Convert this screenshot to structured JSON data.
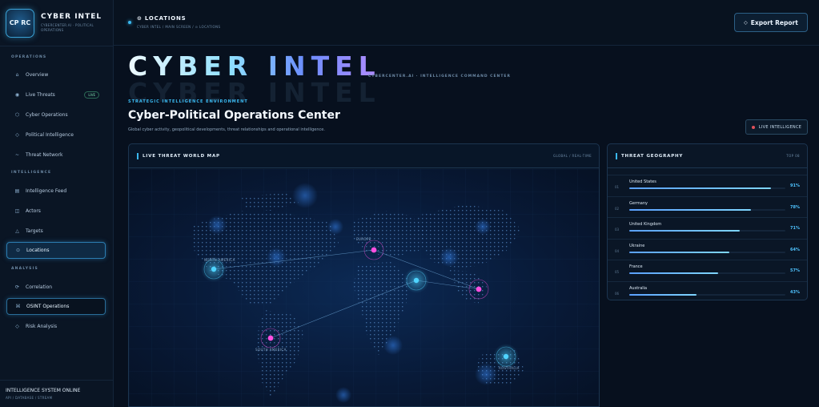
{
  "brand": {
    "logo_text": "CP RC",
    "title": "CYBER INTEL",
    "subtitle": "CYBERCENTER.AI · POLITICAL OPERATIONS"
  },
  "sidebar": {
    "sections": [
      "OPERATIONS",
      "INTELLIGENCE",
      "ANALYSIS"
    ],
    "items": [
      {
        "label": "Overview",
        "icon": "home-icon",
        "glyph": "⌂"
      },
      {
        "label": "Live Threats",
        "icon": "live-threats-icon",
        "glyph": "◉",
        "badge": "LIVE"
      },
      {
        "label": "Cyber Operations",
        "icon": "cyber-ops-icon",
        "glyph": "⬡"
      },
      {
        "label": "Political Intelligence",
        "icon": "political-icon",
        "glyph": "◇"
      },
      {
        "label": "Threat Network",
        "icon": "network-icon",
        "glyph": "~"
      },
      {
        "label": "Intelligence Feed",
        "icon": "feed-icon",
        "glyph": "▤"
      },
      {
        "label": "Actors",
        "icon": "actors-icon",
        "glyph": "◫"
      },
      {
        "label": "Targets",
        "icon": "targets-icon",
        "glyph": "△"
      },
      {
        "label": "Locations",
        "icon": "locations-icon",
        "glyph": "⊙"
      },
      {
        "label": "Correlation",
        "icon": "correlation-icon",
        "glyph": "⟳"
      },
      {
        "label": "OSINT Operations",
        "icon": "osint-icon",
        "glyph": "⌘"
      },
      {
        "label": "Risk Analysis",
        "icon": "risk-icon",
        "glyph": "◇"
      }
    ],
    "status_title": "INTELLIGENCE SYSTEM ONLINE",
    "status_sub": "API / DATABASE / STREAM"
  },
  "topbar": {
    "title": "LOCATIONS",
    "path": "CYBER INTEL / MAIN SCREEN / ⊙ LOCATIONS",
    "export_label": "Export Report"
  },
  "hero": {
    "title": "CYBER INTEL",
    "tag": "CYBERCENTER.AI · INTELLIGENCE COMMAND CENTER",
    "kicker": "STRATEGIC INTELLIGENCE ENVIRONMENT",
    "page_title": "Cyber-Political Operations Center",
    "description": "Global cyber activity, geopolitical developments, threat relationships and operational intelligence.",
    "live_intel": "LIVE INTELLIGENCE"
  },
  "map_panel": {
    "title": "LIVE THREAT WORLD MAP",
    "meta": "GLOBAL / REAL-TIME",
    "labels": [
      "NORTH AMERICA",
      "EUROPE",
      "SOUTH AMERICA",
      "AUSTRALIA"
    ]
  },
  "geo_panel": {
    "title": "THREAT GEOGRAPHY",
    "meta": "TOP 08",
    "rows": [
      {
        "rank": "01",
        "country": "United States",
        "value": "91%",
        "level": 0.91
      },
      {
        "rank": "02",
        "country": "Germany",
        "value": "78%",
        "level": 0.78
      },
      {
        "rank": "03",
        "country": "United Kingdom",
        "value": "71%",
        "level": 0.71
      },
      {
        "rank": "04",
        "country": "Ukraine",
        "value": "64%",
        "level": 0.64
      },
      {
        "rank": "05",
        "country": "France",
        "value": "57%",
        "level": 0.57
      },
      {
        "rank": "06",
        "country": "Australia",
        "value": "43%",
        "level": 0.43
      }
    ]
  },
  "colors": {
    "accent": "#3ab8ef",
    "node_cyan": "#4fd4ff",
    "node_magenta": "#ff4fe0",
    "background": "#07101e"
  }
}
